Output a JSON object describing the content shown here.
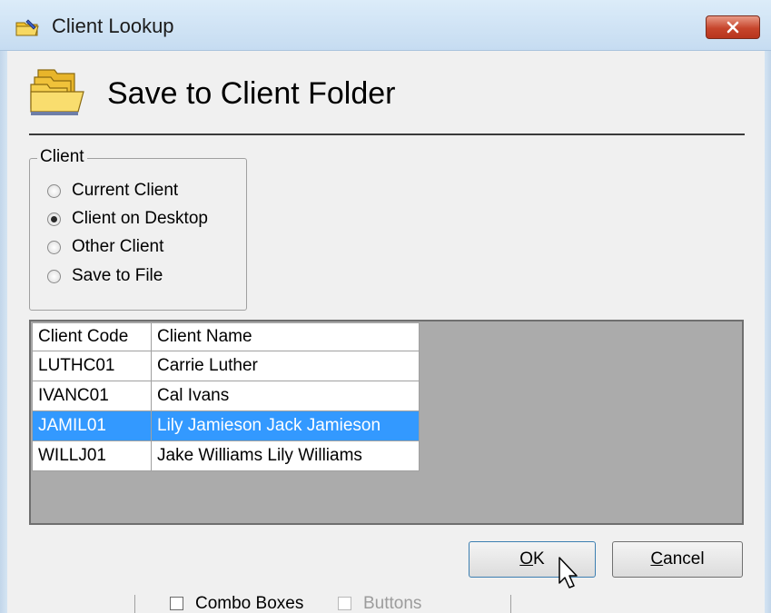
{
  "window": {
    "title": "Client Lookup",
    "close_glyph": "✕"
  },
  "header": {
    "title": "Save to Client Folder"
  },
  "client_group": {
    "legend": "Client",
    "options": [
      {
        "label": "Current Client",
        "checked": false
      },
      {
        "label": "Client on Desktop",
        "checked": true
      },
      {
        "label": "Other Client",
        "checked": false
      },
      {
        "label": "Save to File",
        "checked": false
      }
    ]
  },
  "grid": {
    "columns": [
      "Client Code",
      "Client Name"
    ],
    "rows": [
      [
        "LUTHC01",
        "Carrie Luther"
      ],
      [
        "IVANC01",
        "Cal Ivans"
      ],
      [
        "JAMIL01",
        "Lily Jamieson Jack Jamieson"
      ],
      [
        "WILLJ01",
        "Jake Williams Lily Williams"
      ]
    ],
    "selected_row": 2
  },
  "buttons": {
    "ok_accel": "O",
    "ok_rest": "K",
    "cancel_accel": "C",
    "cancel_rest": "ancel"
  },
  "bottom_bar": {
    "combo_boxes": "Combo Boxes",
    "buttons": "Buttons"
  },
  "colors": {
    "selection": "#3399ff",
    "grid_background": "#ababab",
    "close_button": "#c6452c"
  }
}
